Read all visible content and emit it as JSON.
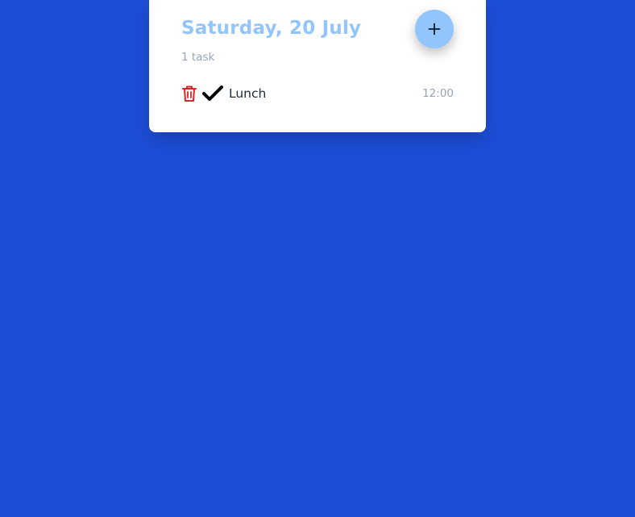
{
  "day": {
    "title": "Saturday, 20 July",
    "task_count": "1 task",
    "add_button_icon": "plus-icon"
  },
  "tasks": [
    {
      "title": "Lunch",
      "time": "12:00",
      "done": true,
      "delete_icon": "trash-icon",
      "status_icon": "check-icon"
    }
  ],
  "colors": {
    "background": "#1d4ed8",
    "card": "#ffffff",
    "accent": "#93c5fd",
    "muted": "#94a3b8",
    "delete": "#dc2626",
    "text": "#1f2937"
  }
}
